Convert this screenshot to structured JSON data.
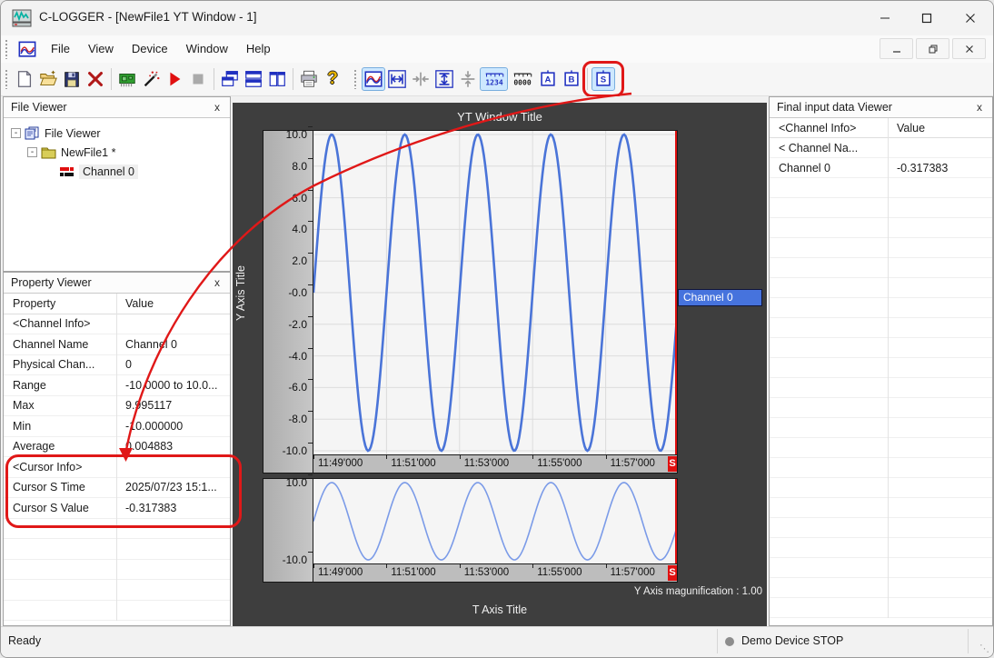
{
  "window": {
    "title": "C-LOGGER - [NewFile1 YT Window - 1]",
    "controls": [
      "minimize",
      "maximize",
      "close"
    ],
    "mdi_controls": [
      "mdi-minimize",
      "mdi-restore",
      "mdi-close"
    ]
  },
  "menu": {
    "items": [
      "File",
      "View",
      "Device",
      "Window",
      "Help"
    ]
  },
  "toolbars": {
    "main": [
      {
        "name": "new-file"
      },
      {
        "name": "open-file"
      },
      {
        "name": "save"
      },
      {
        "name": "delete"
      },
      {
        "sep": true
      },
      {
        "name": "device"
      },
      {
        "name": "wizard"
      },
      {
        "name": "start"
      },
      {
        "name": "stop"
      },
      {
        "sep": true
      },
      {
        "name": "cascade-windows"
      },
      {
        "name": "tile-horizontal"
      },
      {
        "name": "tile-vertical"
      },
      {
        "sep": true
      },
      {
        "name": "print"
      },
      {
        "name": "help"
      }
    ],
    "yt": [
      {
        "name": "yt-window",
        "active": true
      },
      {
        "name": "fit-horizontal"
      },
      {
        "name": "shrink-horizontal"
      },
      {
        "name": "fit-vertical"
      },
      {
        "name": "shrink-vertical"
      },
      {
        "name": "scale-1234",
        "label": "1234",
        "active": true,
        "wide": true
      },
      {
        "name": "scale-0000",
        "label": "0000",
        "wide": true
      },
      {
        "name": "cursor-a",
        "label": "A"
      },
      {
        "name": "cursor-b",
        "label": "B"
      },
      {
        "sep": true
      },
      {
        "name": "cursor-s",
        "label": "S",
        "active": true,
        "annotated": true
      }
    ]
  },
  "file_viewer": {
    "title": "File Viewer",
    "close_label": "x",
    "tree": [
      {
        "label": "File Viewer",
        "icon": "files-icon",
        "level": 0,
        "expander": "-"
      },
      {
        "label": "NewFile1 *",
        "icon": "folder-icon",
        "level": 1,
        "expander": "-"
      },
      {
        "label": "Channel 0",
        "icon": "channel-icon",
        "level": 2,
        "selected": true
      }
    ]
  },
  "property_viewer": {
    "title": "Property Viewer",
    "close_label": "x",
    "columns": [
      "Property",
      "Value"
    ],
    "rows": [
      {
        "property": "<Channel Info>",
        "value": ""
      },
      {
        "property": "Channel Name",
        "value": "Channel 0"
      },
      {
        "property": "Physical Chan...",
        "value": "0"
      },
      {
        "property": "Range",
        "value": "-10.0000 to 10.0..."
      },
      {
        "property": "Max",
        "value": "9.995117"
      },
      {
        "property": "Min",
        "value": "-10.000000"
      },
      {
        "property": "Average",
        "value": "0.004883"
      },
      {
        "property": "<Cursor Info>",
        "value": ""
      },
      {
        "property": "Cursor S Time",
        "value": "2025/07/23 15:1..."
      },
      {
        "property": "Cursor S Value",
        "value": "-0.317383"
      }
    ]
  },
  "final_viewer": {
    "title": "Final input data Viewer",
    "close_label": "x",
    "columns": [
      "<Channel Info>",
      "Value"
    ],
    "rows": [
      {
        "name": "< Channel Na...",
        "value": ""
      },
      {
        "name": "Channel 0",
        "value": "-0.317383"
      }
    ]
  },
  "chart_data": {
    "type": "line",
    "title": "YT Window Title",
    "y_axis_title": "Y Axis Title",
    "t_axis_title": "T Axis Title",
    "magnification_label": "Y Axis magunification : 1.00",
    "channel_badge": "Channel 0",
    "cursor_label": "S",
    "ylim": [
      -10,
      10
    ],
    "yticks_main": [
      10.0,
      8.0,
      6.0,
      4.0,
      2.0,
      -0.0,
      -2.0,
      -4.0,
      -6.0,
      -8.0,
      -10.0
    ],
    "ytick_labels_main": [
      "10.0",
      "8.0",
      "6.0",
      "4.0",
      "2.0",
      "-0.0",
      "-2.0",
      "-4.0",
      "-6.0",
      "-8.0",
      "-10.0"
    ],
    "ytick_labels_overview": [
      "10.0",
      "-10.0"
    ],
    "xticks": [
      "11:49'000",
      "11:51'000",
      "11:53'000",
      "11:55'000",
      "11:57'000"
    ],
    "series": [
      {
        "name": "Channel 0",
        "amplitude": 10,
        "cycles": 5,
        "color": "#4a74d8",
        "overview_color": "#7b9be8",
        "cursor_s_value": -0.317383
      }
    ],
    "grid": true,
    "cursor_color": "#e01010"
  },
  "status": {
    "ready": "Ready",
    "device_status": "Demo Device STOP"
  },
  "annotations": {
    "highlight_color": "#e01818"
  }
}
